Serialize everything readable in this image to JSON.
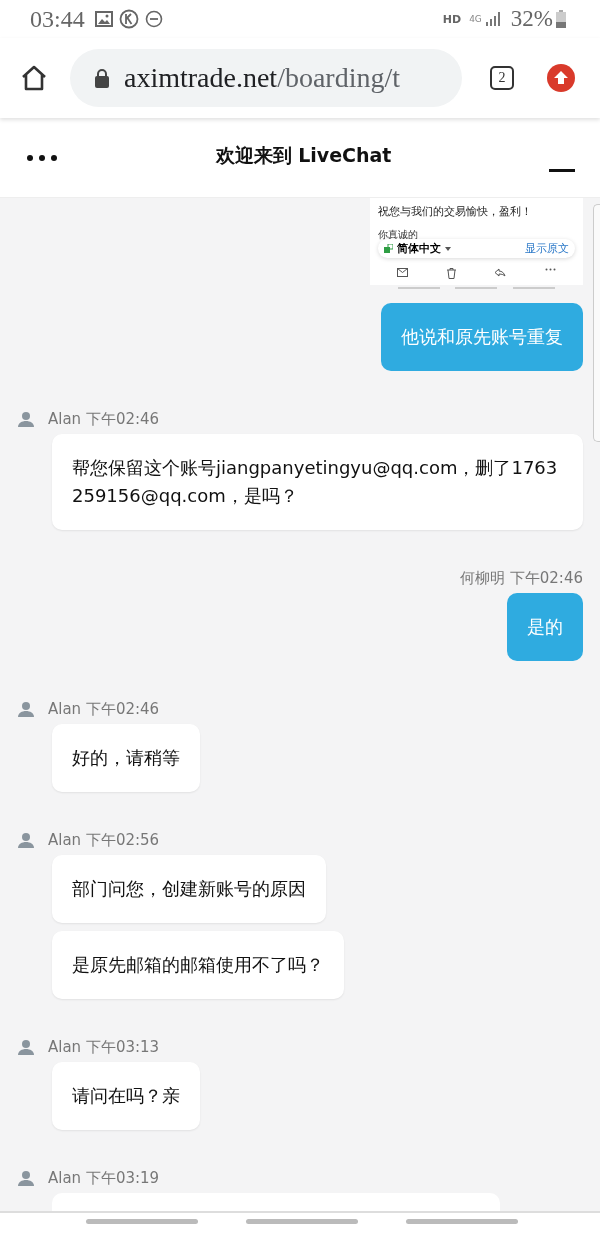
{
  "status_bar": {
    "time": "03:44",
    "network_hd": "HD",
    "network_type": "4G",
    "battery": "32%"
  },
  "browser": {
    "url_host": "aximtrade.net",
    "url_path": "/boarding/t",
    "tab_count": "2"
  },
  "chat_header": {
    "title": "欢迎来到 LiveChat"
  },
  "messages": [
    {
      "kind": "image",
      "lines": [
        "祝您与我们的交易愉快，盈利！",
        "你真诚的"
      ],
      "language": "简体中文",
      "show_original": "显示原文"
    },
    {
      "kind": "visitor",
      "bubbles": [
        "他说和原先账号重复"
      ]
    },
    {
      "kind": "agent",
      "author": "Alan",
      "time": "下午02:46",
      "bubbles": [
        "帮您保留这个账号jiangpanyetingyu@qq.com，删了1763259156@qq.com，是吗？"
      ]
    },
    {
      "kind": "visitor",
      "author": "何柳明",
      "time": "下午02:46",
      "bubbles": [
        "是的"
      ]
    },
    {
      "kind": "agent",
      "author": "Alan",
      "time": "下午02:46",
      "bubbles": [
        "好的，请稍等"
      ]
    },
    {
      "kind": "agent",
      "author": "Alan",
      "time": "下午02:56",
      "bubbles": [
        "部门问您，创建新账号的原因",
        "是原先邮箱的邮箱使用不了吗？"
      ]
    },
    {
      "kind": "agent",
      "author": "Alan",
      "time": "下午03:13",
      "bubbles": [
        "请问在吗？亲"
      ]
    },
    {
      "kind": "partial",
      "author": "Alan",
      "time": "下午03:19"
    }
  ]
}
